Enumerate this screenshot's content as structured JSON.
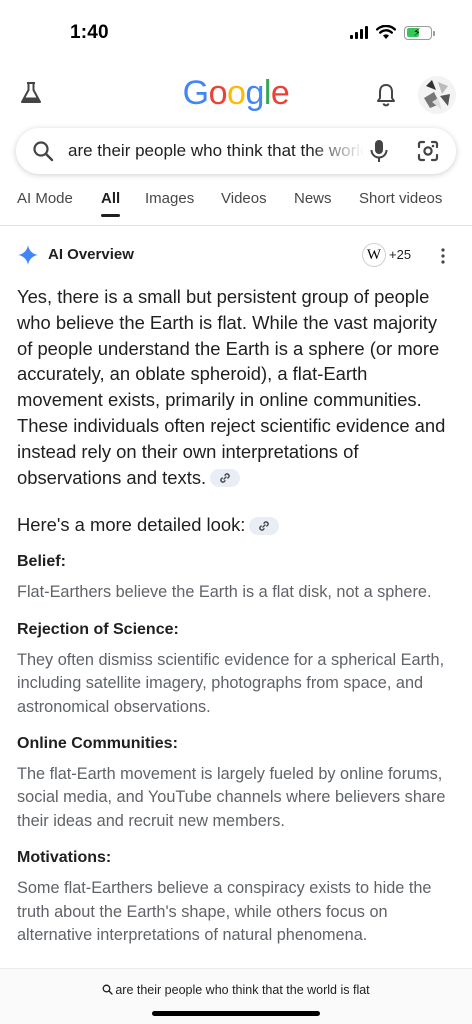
{
  "status_bar": {
    "time": "1:40"
  },
  "header": {
    "logo_letters": [
      {
        "char": "G",
        "color": "#4285F4"
      },
      {
        "char": "o",
        "color": "#EA4335"
      },
      {
        "char": "o",
        "color": "#FBBC05"
      },
      {
        "char": "g",
        "color": "#4285F4"
      },
      {
        "char": "l",
        "color": "#34A853"
      },
      {
        "char": "e",
        "color": "#EA4335"
      }
    ]
  },
  "search": {
    "query": "are their people who think that the world is flat"
  },
  "tabs": [
    {
      "label": "AI Mode",
      "active": false
    },
    {
      "label": "All",
      "active": true
    },
    {
      "label": "Images",
      "active": false
    },
    {
      "label": "Videos",
      "active": false
    },
    {
      "label": "News",
      "active": false
    },
    {
      "label": "Short videos",
      "active": false
    }
  ],
  "ai_overview": {
    "title": "AI Overview",
    "source_icon_letter": "W",
    "source_count": "+25",
    "summary": "Yes, there is a small but persistent group of people who believe the Earth is flat. While the vast majority of people understand the Earth is a sphere (or more accurately, an oblate spheroid), a flat-Earth movement exists, primarily in online communities. These individuals often reject scientific evidence and instead rely on their own interpretations of observations and texts.",
    "detail_heading": "Here's a more detailed look:",
    "sections": [
      {
        "title": "Belief:",
        "body": "Flat-Earthers believe the Earth is a flat disk, not a sphere."
      },
      {
        "title": "Rejection of Science:",
        "body": "They often dismiss scientific evidence for a spherical Earth, including satellite imagery, photographs from space, and astronomical observations."
      },
      {
        "title": "Online Communities:",
        "body": "The flat-Earth movement is largely fueled by online forums, social media, and YouTube channels where believers share their ideas and recruit new members."
      },
      {
        "title": "Motivations:",
        "body": "Some flat-Earthers believe a conspiracy exists to hide the truth about the Earth's shape, while others focus on alternative interpretations of natural phenomena."
      }
    ]
  },
  "bottom_bar": {
    "query": "are their people who think that the world is flat"
  },
  "colors": {
    "sparkle": "#4285F4",
    "battery_fill": "#35C759",
    "secondary_text": "#5F6368",
    "chip_bg": "#E9EEF6"
  }
}
